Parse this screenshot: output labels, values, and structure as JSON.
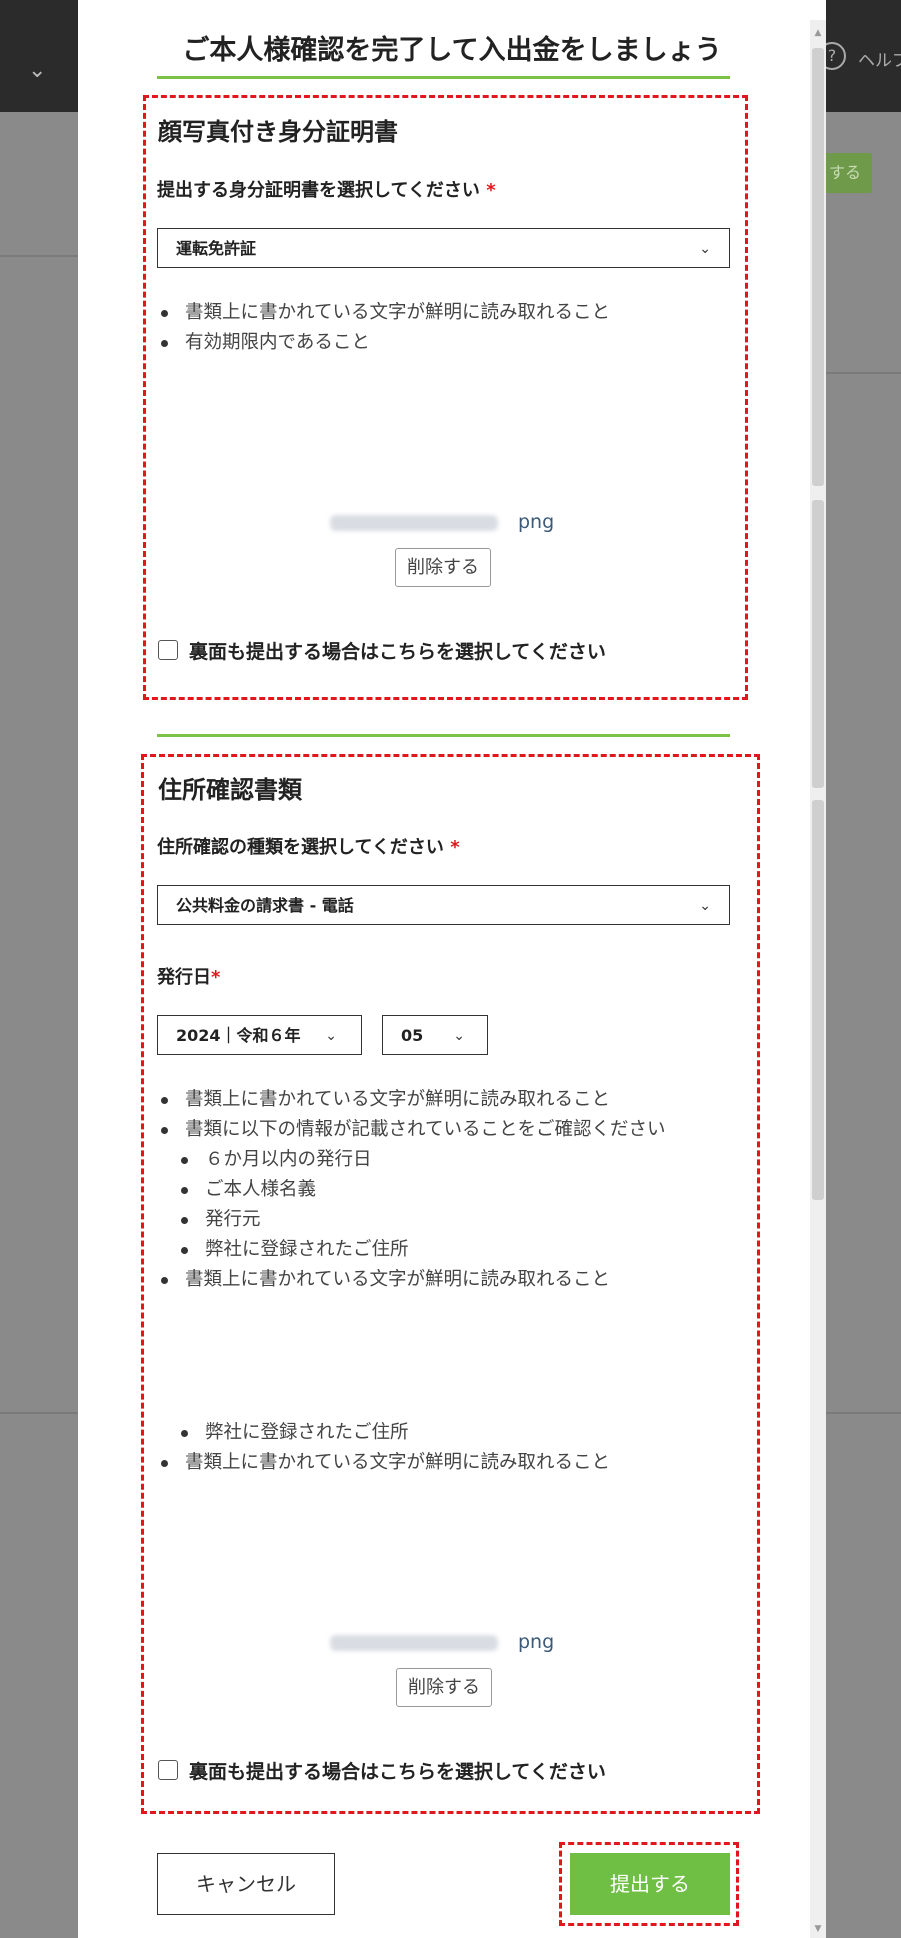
{
  "background": {
    "help_label": "ヘルプ",
    "action_label": "する"
  },
  "modal": {
    "title": "ご本人様確認を完了して入出金をしましょう"
  },
  "id_section": {
    "heading": "顔写真付き身分証明書",
    "select_label": "提出する身分証明書を選択してください",
    "required_mark": "*",
    "select_value": "運転免許証",
    "bullets": [
      "書類上に書かれている文字が鮮明に読み取れること",
      "有効期限内であること"
    ],
    "file_ext": "png",
    "delete_label": "削除する",
    "backside_label": "裏面も提出する場合はこちらを選択してください"
  },
  "address_section": {
    "heading": "住所確認書類",
    "select_label": "住所確認の種類を選択してください",
    "required_mark": "*",
    "select_value": "公共料金の請求書 - 電話",
    "date_label": "発行日",
    "date_required_mark": "*",
    "year_value": "2024｜令和６年",
    "month_value": "05",
    "bullets_a": [
      "書類上に書かれている文字が鮮明に読み取れること",
      "書類に以下の情報が記載されていることをご確認ください"
    ],
    "sub_bullets": [
      "６か月以内の発行日",
      "ご本人様名義",
      "発行元",
      "弊社に登録されたご住所"
    ],
    "bullets_b": [
      "書類上に書かれている文字が鮮明に読み取れること"
    ],
    "sub_bullet_repeat": "弊社に登録されたご住所",
    "bullet_repeat": "書類上に書かれている文字が鮮明に読み取れること",
    "file_ext": "png",
    "delete_label": "削除する",
    "backside_label": "裏面も提出する場合はこちらを選択してください"
  },
  "footer": {
    "cancel_label": "キャンセル",
    "submit_label": "提出する"
  }
}
